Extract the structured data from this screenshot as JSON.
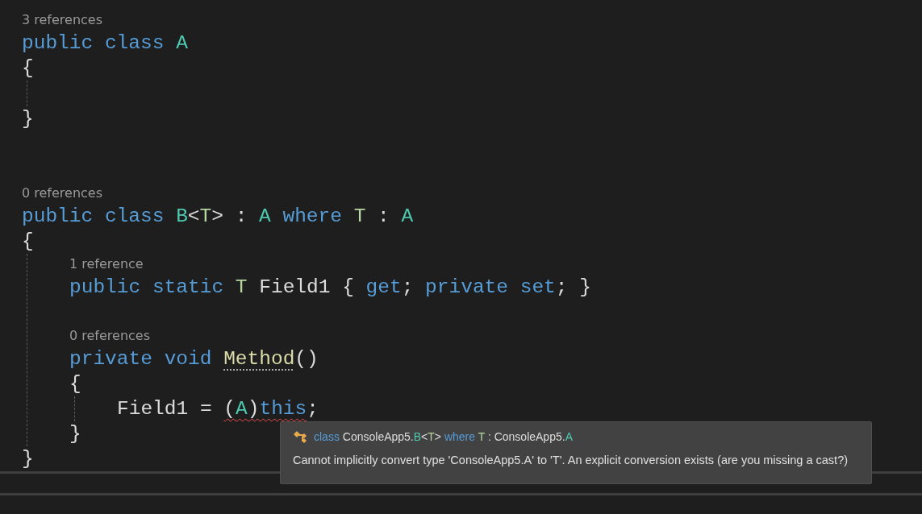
{
  "code": [
    {
      "kind": "lens",
      "text": "3 references"
    },
    {
      "kind": "code",
      "tokens": [
        {
          "kind": "keyword",
          "text": "public "
        },
        {
          "kind": "keyword",
          "text": "class "
        },
        {
          "kind": "type",
          "text": "A"
        }
      ]
    },
    {
      "kind": "code",
      "tokens": [
        {
          "kind": "plain",
          "text": "{"
        }
      ]
    },
    {
      "kind": "block",
      "children": [
        {
          "kind": "blank"
        }
      ]
    },
    {
      "kind": "code",
      "tokens": [
        {
          "kind": "plain",
          "text": "}"
        }
      ]
    },
    {
      "kind": "blank"
    },
    {
      "kind": "blank"
    },
    {
      "kind": "lens",
      "text": "0 references"
    },
    {
      "kind": "code",
      "tokens": [
        {
          "kind": "keyword",
          "text": "public "
        },
        {
          "kind": "keyword",
          "text": "class "
        },
        {
          "kind": "type",
          "text": "B"
        },
        {
          "kind": "plain",
          "text": "<"
        },
        {
          "kind": "typeparam",
          "text": "T"
        },
        {
          "kind": "plain",
          "text": "> : "
        },
        {
          "kind": "type",
          "text": "A "
        },
        {
          "kind": "keyword",
          "text": "where "
        },
        {
          "kind": "typeparam",
          "text": "T"
        },
        {
          "kind": "plain",
          "text": " : "
        },
        {
          "kind": "type",
          "text": "A"
        }
      ]
    },
    {
      "kind": "code",
      "tokens": [
        {
          "kind": "plain",
          "text": "{"
        }
      ]
    },
    {
      "kind": "block",
      "children": [
        {
          "kind": "lens",
          "text": "1 reference"
        },
        {
          "kind": "code",
          "tokens": [
            {
              "kind": "keyword",
              "text": "public "
            },
            {
              "kind": "keyword",
              "text": "static "
            },
            {
              "kind": "typeparam",
              "text": "T"
            },
            {
              "kind": "plain",
              "text": " Field1 { "
            },
            {
              "kind": "keyword",
              "text": "get"
            },
            {
              "kind": "plain",
              "text": "; "
            },
            {
              "kind": "keyword",
              "text": "private "
            },
            {
              "kind": "keyword",
              "text": "set"
            },
            {
              "kind": "plain",
              "text": "; }"
            }
          ]
        },
        {
          "kind": "blank"
        },
        {
          "kind": "lens",
          "text": "0 references"
        },
        {
          "kind": "code",
          "tokens": [
            {
              "kind": "keyword",
              "text": "private "
            },
            {
              "kind": "keyword",
              "text": "void "
            },
            {
              "kind": "method",
              "text": "Method",
              "suggestion": true
            },
            {
              "kind": "plain",
              "text": "()"
            }
          ]
        },
        {
          "kind": "code",
          "tokens": [
            {
              "kind": "plain",
              "text": "{"
            }
          ]
        },
        {
          "kind": "block",
          "children": [
            {
              "kind": "code",
              "tokens": [
                {
                  "kind": "plain",
                  "text": "Field1 = "
                },
                {
                  "kind": "plain",
                  "text": "(",
                  "error": true
                },
                {
                  "kind": "type",
                  "text": "A",
                  "error": true
                },
                {
                  "kind": "plain",
                  "text": ")",
                  "error": true
                },
                {
                  "kind": "keyword",
                  "text": "this",
                  "error": true
                },
                {
                  "kind": "plain",
                  "text": ";"
                }
              ]
            }
          ]
        },
        {
          "kind": "code",
          "tokens": [
            {
              "kind": "plain",
              "text": "}"
            }
          ]
        }
      ]
    },
    {
      "kind": "code",
      "tokens": [
        {
          "kind": "plain",
          "text": "}"
        }
      ]
    }
  ],
  "tooltip": {
    "signature": [
      {
        "kind": "keyword",
        "text": "class"
      },
      {
        "kind": "plain",
        "text": " ConsoleApp5."
      },
      {
        "kind": "type",
        "text": "B"
      },
      {
        "kind": "plain",
        "text": "<"
      },
      {
        "kind": "typeparam",
        "text": "T"
      },
      {
        "kind": "plain",
        "text": "> "
      },
      {
        "kind": "keyword",
        "text": "where"
      },
      {
        "kind": "typeparam",
        "text": " T"
      },
      {
        "kind": "plain",
        "text": " : ConsoleApp5."
      },
      {
        "kind": "type",
        "text": "A"
      }
    ],
    "message": "Cannot implicitly convert type 'ConsoleApp5.A' to 'T'. An explicit conversion exists (are you missing a cast?)"
  }
}
